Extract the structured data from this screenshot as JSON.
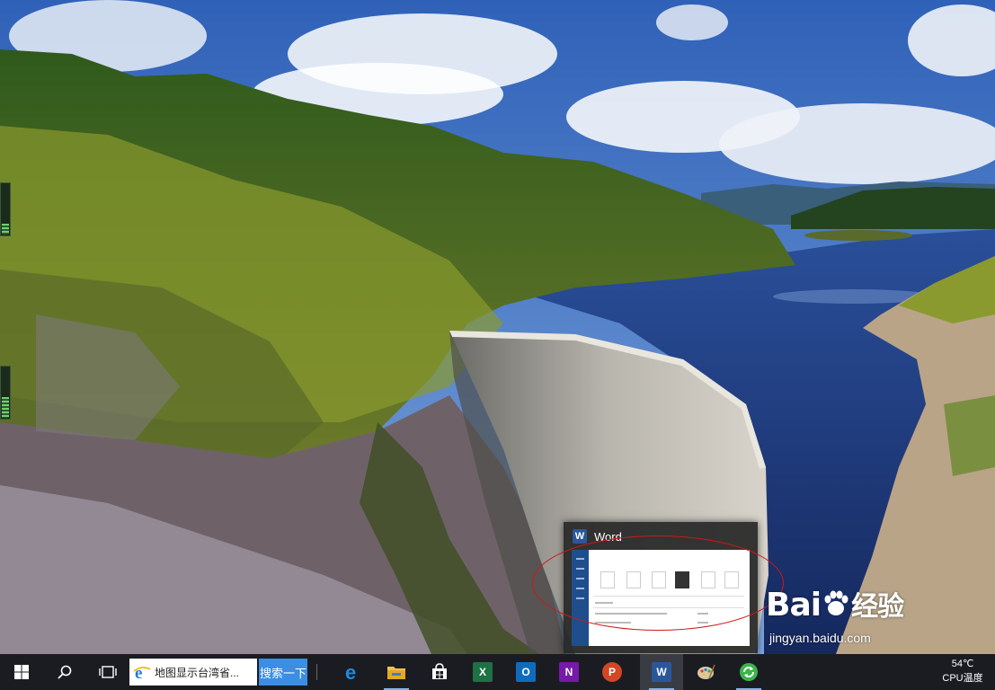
{
  "preview": {
    "app_title": "Word",
    "icon": "word-icon"
  },
  "taskbar": {
    "start_icon": "windows-start-icon",
    "search_icon": "search-icon",
    "task_view_icon": "task-view-icon",
    "search_box_text": "地图显示台湾省...",
    "search_button_label": "搜索一下",
    "apps": [
      {
        "name": "edge",
        "icon": "edge-icon",
        "running": false
      },
      {
        "name": "file-explorer",
        "icon": "folder-icon",
        "running": true
      },
      {
        "name": "store",
        "icon": "store-icon",
        "running": false
      },
      {
        "name": "excel",
        "icon": "excel-icon",
        "letter": "X",
        "running": false
      },
      {
        "name": "outlook",
        "icon": "outlook-icon",
        "letter": "O",
        "running": false
      },
      {
        "name": "onenote",
        "icon": "onenote-icon",
        "letter": "N",
        "running": false
      },
      {
        "name": "powerpoint",
        "icon": "powerpoint-icon",
        "letter": "P",
        "running": false
      },
      {
        "name": "word",
        "icon": "word-icon",
        "letter": "W",
        "running": true
      },
      {
        "name": "paint",
        "icon": "paint-icon",
        "running": false
      },
      {
        "name": "360",
        "icon": "refresh-icon",
        "running": true
      }
    ],
    "tray": {
      "temperature": "54℃",
      "label": "CPU温度"
    }
  },
  "watermark": {
    "brand_text": "Bai",
    "brand_suffix": "经验",
    "site": "jingyan.baidu.com"
  },
  "colors": {
    "taskbar_bg": "#1b1c22",
    "search_button": "#3b8ee3",
    "annotation": "#d01818",
    "word_blue": "#2b579a"
  }
}
